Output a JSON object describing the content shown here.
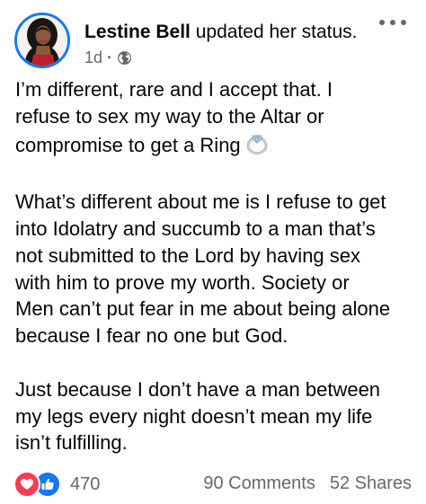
{
  "post": {
    "author": "Lestine Bell",
    "action": "updated her status.",
    "time": "1d",
    "separator": "·",
    "privacy_icon": "globe-icon",
    "more_icon": "more-options-icon",
    "paragraphs": [
      {
        "lines": [
          "I’m different, rare and I accept that. I",
          "refuse to sex my way to the Altar or",
          "compromise to get a Ring"
        ],
        "emoji": "ring-emoji"
      },
      {
        "lines": [
          "What’s different about me is I refuse to get",
          "into Idolatry and succumb to a man that’s",
          "not submitted to the Lord by having sex",
          "with him to prove my worth. Society or",
          "Men can’t put fear in me about being alone",
          "because I fear no one but God."
        ]
      },
      {
        "lines": [
          "Just because I don’t have a man between",
          "my legs every night doesn’t mean my life",
          "isn’t fulfilling."
        ]
      }
    ]
  },
  "reactions": {
    "icons": [
      "love-reaction-icon",
      "like-reaction-icon"
    ],
    "count": "470"
  },
  "stats": {
    "comments": "90 Comments",
    "shares": "52 Shares"
  },
  "colors": {
    "accent": "#1877f2",
    "love": "#f33e58",
    "secondary_text": "#65676b",
    "primary_text": "#050505"
  }
}
